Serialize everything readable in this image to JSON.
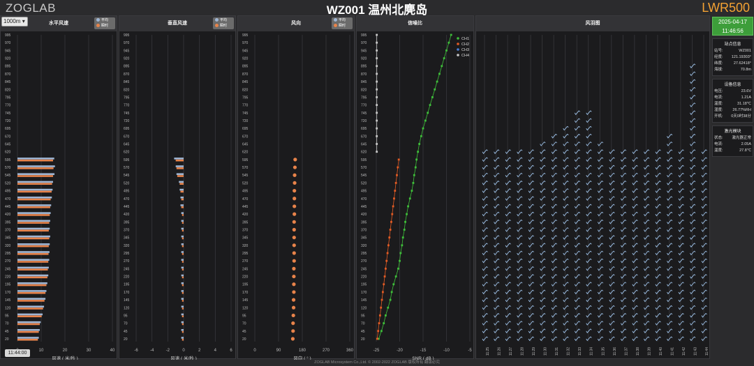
{
  "header": {
    "logo": "ZOGLAB",
    "title": "WZ001 温州北麂岛",
    "device": "LWR500"
  },
  "controls": {
    "range_select": "1000m",
    "time_chip": "11:44:00"
  },
  "heights": [
    995,
    970,
    945,
    920,
    895,
    870,
    845,
    820,
    795,
    770,
    745,
    720,
    695,
    670,
    645,
    620,
    595,
    570,
    545,
    520,
    495,
    470,
    445,
    420,
    395,
    370,
    345,
    320,
    295,
    270,
    245,
    220,
    195,
    170,
    145,
    120,
    95,
    70,
    45,
    20
  ],
  "legend": {
    "avg": "平均",
    "inst": "瞬时",
    "avg_color": "#9fb6d4",
    "inst_color": "#e8834a"
  },
  "panels": {
    "h_speed": {
      "title": "水平风速",
      "xlabel": "风速 ( 米/秒 )",
      "xticks": [
        "0",
        "10",
        "20",
        "30",
        "40"
      ],
      "xlim": [
        0,
        40
      ]
    },
    "v_speed": {
      "title": "垂直风速",
      "xlabel": "风速 ( 米/秒 )",
      "xticks": [
        "-6",
        "-4",
        "-2",
        "0",
        "2",
        "4",
        "6"
      ],
      "xlim": [
        -6,
        6
      ]
    },
    "dir": {
      "title": "风向",
      "xlabel": "风向 ( ° )",
      "xticks": [
        "0",
        "90",
        "180",
        "270",
        "360"
      ],
      "xlim": [
        0,
        360
      ]
    },
    "snr": {
      "title": "信噪比",
      "xlabel": "SNR ( dB )",
      "xticks": [
        "-25",
        "-20",
        "-15",
        "-10",
        "-5"
      ],
      "xlim": [
        -25,
        -5
      ]
    },
    "barbs": {
      "title": "风羽图"
    }
  },
  "chart_data": [
    {
      "type": "bar",
      "title": "水平风速",
      "xlabel": "风速 ( 米/秒 )",
      "ylabel": "",
      "categories": [
        595,
        570,
        545,
        520,
        495,
        470,
        445,
        420,
        395,
        370,
        345,
        320,
        295,
        270,
        245,
        220,
        195,
        170,
        145,
        120,
        95,
        70,
        45,
        20
      ],
      "series": [
        {
          "name": "平均",
          "values": [
            15.5,
            15.8,
            15.6,
            15.0,
            14.8,
            14.5,
            14.2,
            14.0,
            13.8,
            13.6,
            13.8,
            13.6,
            13.5,
            13.4,
            13.2,
            13.0,
            12.6,
            12.2,
            11.8,
            11.2,
            10.6,
            9.8,
            9.4,
            9.0
          ]
        },
        {
          "name": "瞬时",
          "values": [
            15.0,
            15.2,
            15.0,
            14.6,
            14.4,
            14.0,
            13.8,
            13.6,
            13.4,
            13.2,
            13.4,
            13.2,
            13.1,
            13.0,
            12.8,
            12.6,
            12.2,
            11.8,
            11.4,
            10.8,
            10.2,
            9.4,
            9.0,
            8.6
          ]
        }
      ],
      "xlim": [
        0,
        40
      ]
    },
    {
      "type": "bar",
      "title": "垂直风速",
      "xlabel": "风速 ( 米/秒 )",
      "categories": [
        595,
        570,
        545,
        520,
        495,
        470,
        445,
        420,
        395,
        370,
        345,
        320,
        295,
        270,
        245,
        220,
        195,
        170,
        145,
        120,
        95,
        70,
        45,
        20
      ],
      "series": [
        {
          "name": "平均",
          "values": [
            -1.2,
            -1.0,
            -0.9,
            -0.6,
            -0.5,
            -0.4,
            -0.4,
            -0.3,
            -0.3,
            -0.3,
            -0.3,
            -0.3,
            -0.3,
            -0.3,
            -0.3,
            -0.3,
            -0.3,
            -0.3,
            -0.3,
            -0.3,
            -0.3,
            -0.3,
            -0.3,
            -0.3
          ]
        },
        {
          "name": "瞬时",
          "values": [
            -1.0,
            -0.9,
            -0.8,
            -0.5,
            -0.4,
            -0.3,
            -0.3,
            -0.2,
            -0.2,
            -0.2,
            -0.2,
            -0.2,
            -0.2,
            -0.2,
            -0.2,
            -0.2,
            -0.2,
            -0.2,
            -0.2,
            -0.2,
            -0.2,
            -0.2,
            -0.2,
            -0.2
          ]
        }
      ],
      "xlim": [
        -6,
        6
      ]
    },
    {
      "type": "scatter",
      "title": "风向",
      "xlabel": "风向 ( ° )",
      "y": [
        595,
        570,
        545,
        520,
        495,
        470,
        445,
        420,
        395,
        370,
        345,
        320,
        295,
        270,
        245,
        220,
        195,
        170,
        145,
        120,
        95,
        70,
        45,
        20
      ],
      "series": [
        {
          "name": "瞬时",
          "values": [
            153,
            152,
            151,
            151,
            150,
            150,
            150,
            150,
            149,
            149,
            149,
            149,
            149,
            149,
            148,
            148,
            148,
            148,
            147,
            147,
            146,
            145,
            145,
            144
          ]
        }
      ],
      "xlim": [
        0,
        360
      ]
    },
    {
      "type": "line",
      "title": "信噪比",
      "xlabel": "SNR ( dB )",
      "series": [
        {
          "name": "CH1",
          "color": "#3fbf3a",
          "points": [
            [
              -24.5,
              20
            ],
            [
              -23.9,
              45
            ],
            [
              -23.4,
              70
            ],
            [
              -23.0,
              95
            ],
            [
              -22.5,
              120
            ],
            [
              -22.0,
              145
            ],
            [
              -21.7,
              170
            ],
            [
              -21.3,
              195
            ],
            [
              -20.8,
              220
            ],
            [
              -20.3,
              245
            ],
            [
              -20.0,
              270
            ],
            [
              -19.8,
              295
            ],
            [
              -19.5,
              320
            ],
            [
              -19.3,
              345
            ],
            [
              -19.0,
              370
            ],
            [
              -18.8,
              395
            ],
            [
              -18.5,
              420
            ],
            [
              -18.2,
              445
            ],
            [
              -17.8,
              470
            ],
            [
              -17.4,
              495
            ],
            [
              -17.1,
              520
            ],
            [
              -16.9,
              545
            ],
            [
              -16.6,
              570
            ],
            [
              -16.4,
              595
            ],
            [
              -16.1,
              620
            ],
            [
              -15.8,
              645
            ],
            [
              -15.4,
              670
            ],
            [
              -15.0,
              695
            ],
            [
              -14.5,
              720
            ],
            [
              -14.0,
              745
            ],
            [
              -13.5,
              770
            ],
            [
              -13.0,
              795
            ],
            [
              -12.5,
              820
            ],
            [
              -12.0,
              845
            ],
            [
              -11.5,
              870
            ],
            [
              -11.0,
              895
            ],
            [
              -10.5,
              920
            ],
            [
              -10.0,
              945
            ],
            [
              -9.5,
              970
            ],
            [
              -9.0,
              995
            ]
          ]
        },
        {
          "name": "CH2",
          "color": "#e35b24",
          "points": [
            [
              -24.8,
              20
            ],
            [
              -24.6,
              45
            ],
            [
              -24.4,
              70
            ],
            [
              -24.2,
              95
            ],
            [
              -24.0,
              120
            ],
            [
              -23.8,
              145
            ],
            [
              -23.6,
              170
            ],
            [
              -23.4,
              195
            ],
            [
              -23.2,
              220
            ],
            [
              -23.0,
              245
            ],
            [
              -22.8,
              270
            ],
            [
              -22.6,
              295
            ],
            [
              -22.4,
              320
            ],
            [
              -22.2,
              345
            ],
            [
              -22.0,
              370
            ],
            [
              -21.8,
              395
            ],
            [
              -21.6,
              420
            ],
            [
              -21.4,
              445
            ],
            [
              -21.2,
              470
            ],
            [
              -21.0,
              495
            ],
            [
              -20.8,
              520
            ],
            [
              -20.6,
              545
            ],
            [
              -20.4,
              570
            ],
            [
              -20.2,
              595
            ]
          ]
        },
        {
          "name": "CH3",
          "color": "#4a7fd6",
          "points": []
        },
        {
          "name": "CH4",
          "color": "#c9c9c9",
          "points": [
            [
              -24.9,
              620
            ],
            [
              -24.9,
              645
            ],
            [
              -24.9,
              670
            ],
            [
              -24.9,
              695
            ],
            [
              -24.9,
              720
            ],
            [
              -24.9,
              745
            ],
            [
              -24.9,
              770
            ],
            [
              -24.9,
              795
            ],
            [
              -24.9,
              820
            ],
            [
              -24.9,
              845
            ],
            [
              -24.9,
              870
            ],
            [
              -24.9,
              895
            ],
            [
              -24.9,
              920
            ],
            [
              -24.9,
              945
            ],
            [
              -24.9,
              970
            ],
            [
              -24.9,
              995
            ]
          ]
        }
      ],
      "xlim": [
        -25,
        -5
      ]
    },
    {
      "type": "table",
      "title": "风羽图",
      "x": [
        "11:25",
        "11:26",
        "11:27",
        "11:28",
        "11:29",
        "11:30",
        "11:31",
        "11:32",
        "11:33",
        "11:34",
        "11:35",
        "11:36",
        "11:37",
        "11:38",
        "11:39",
        "11:40",
        "11:41",
        "11:42",
        "11:43",
        "11:44"
      ]
    }
  ],
  "station": {
    "title": "站点信息",
    "rows": [
      [
        "站号:",
        "WZ001"
      ],
      [
        "经度:",
        "121.19303°"
      ],
      [
        "纬度:",
        "27.62418°"
      ],
      [
        "海拔:",
        "70.8m"
      ]
    ]
  },
  "device_info": {
    "title": "设备信息",
    "rows": [
      [
        "电压:",
        "23.6V"
      ],
      [
        "电流:",
        "1.21A"
      ],
      [
        "温度:",
        "31.18℃"
      ],
      [
        "湿度:",
        "26.77%RH"
      ],
      [
        "开机:",
        "0天0时38分"
      ]
    ]
  },
  "laser": {
    "title": "激光模块",
    "rows": [
      [
        "状态:",
        "激光器正常"
      ],
      [
        "电流:",
        "2.05A"
      ],
      [
        "温度:",
        "27.8℃"
      ]
    ]
  },
  "clock": {
    "date": "2025-04-17",
    "time": "11:46:56"
  },
  "footer": "ZOGLAB Microsystem Co.,Ltd. © 2002-2022 ZOGLAB 版权所有 翻版必究",
  "colors": {
    "avg": "#9fb6d4",
    "inst": "#e8834a",
    "grid": "#3a3a3e",
    "snr_ch1": "#3fbf3a",
    "snr_ch2": "#e35b24",
    "snr_ch3": "#4a7fd6",
    "snr_ch4": "#c9c9c9",
    "barb": "#9fc3ea"
  }
}
